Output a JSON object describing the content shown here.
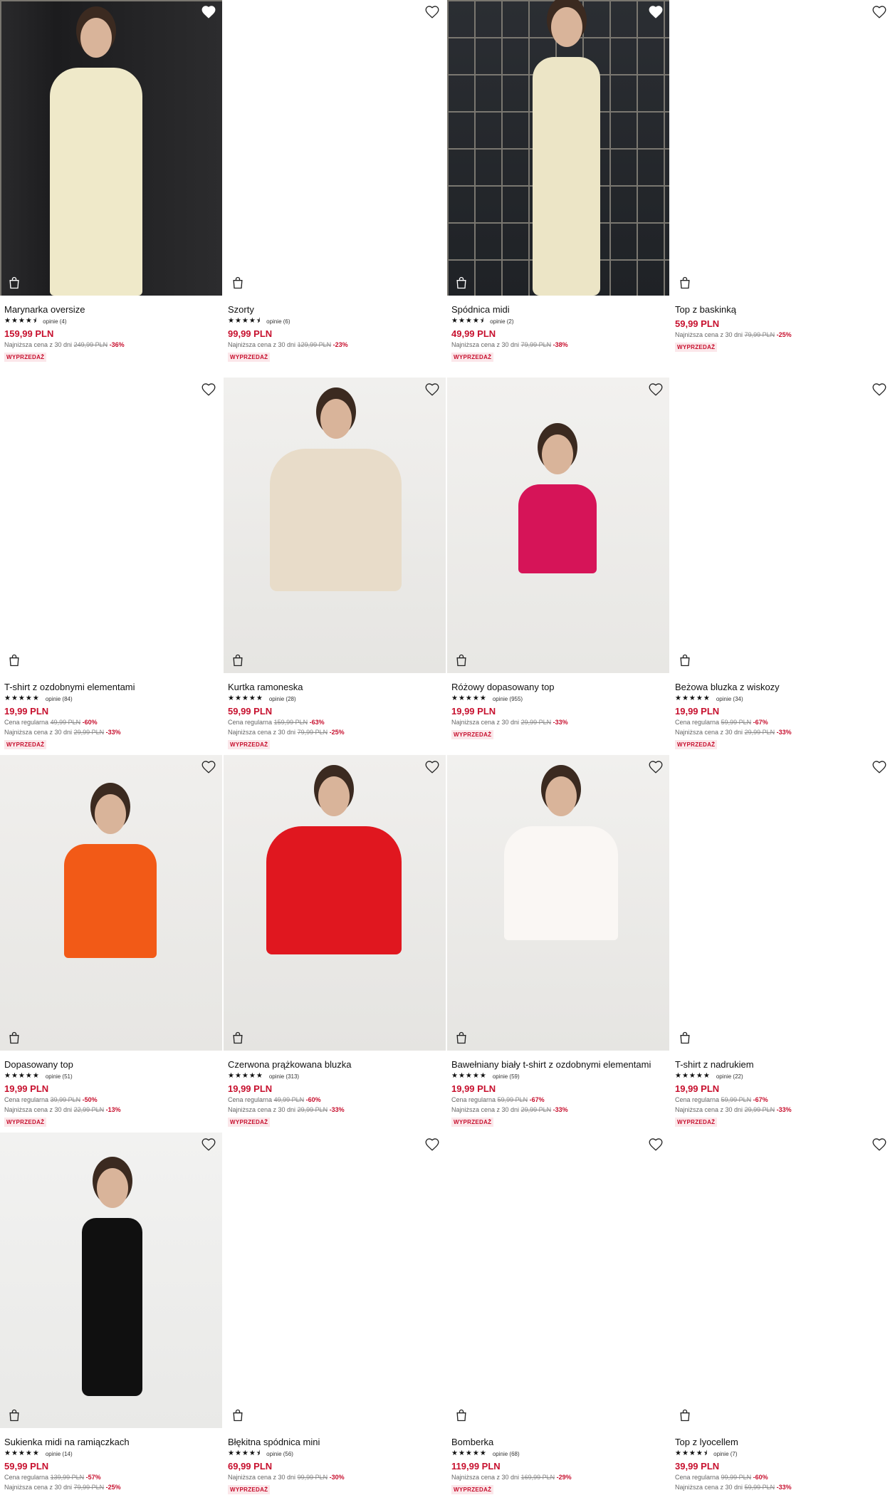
{
  "products": [
    {
      "name": "Marynarka oversize",
      "stars": "★★★★⯨",
      "reviews": "opinie (4)",
      "price": "159,99 PLN",
      "history": [
        {
          "label": "Najniższa cena z 30 dni",
          "old": "249,99 PLN",
          "disc": "-36%"
        }
      ],
      "badge": "WYPRZEDAŻ",
      "favorited": true,
      "image": "photo"
    },
    {
      "name": "Szorty",
      "stars": "★★★★⯨",
      "reviews": "opinie (6)",
      "price": "99,99 PLN",
      "history": [
        {
          "label": "Najniższa cena z 30 dni",
          "old": "129,99 PLN",
          "disc": "-23%"
        }
      ],
      "badge": "WYPRZEDAŻ",
      "favorited": false,
      "image": "blank"
    },
    {
      "name": "Spódnica midi",
      "stars": "★★★★⯨",
      "reviews": "opinie (2)",
      "price": "49,99 PLN",
      "history": [
        {
          "label": "Najniższa cena z 30 dni",
          "old": "79,99 PLN",
          "disc": "-38%"
        }
      ],
      "badge": "WYPRZEDAŻ",
      "favorited": true,
      "image": "photo"
    },
    {
      "name": "Top z baskinką",
      "stars": "",
      "reviews": "",
      "price": "59,99 PLN",
      "history": [
        {
          "label": "Najniższa cena z 30 dni",
          "old": "79,99 PLN",
          "disc": "-25%"
        }
      ],
      "badge": "WYPRZEDAŻ",
      "favorited": false,
      "image": "blank"
    },
    {
      "name": "T-shirt z ozdobnymi elementami",
      "stars": "★★★★★",
      "reviews": "opinie (84)",
      "price": "19,99 PLN",
      "history": [
        {
          "label": "Cena regularna",
          "old": "49,99 PLN",
          "disc": "-60%"
        },
        {
          "label": "Najniższa cena z 30 dni",
          "old": "29,99 PLN",
          "disc": "-33%"
        }
      ],
      "badge": "WYPRZEDAŻ",
      "favorited": false,
      "image": "blank"
    },
    {
      "name": "Kurtka ramoneska",
      "stars": "★★★★★",
      "reviews": "opinie (28)",
      "price": "59,99 PLN",
      "history": [
        {
          "label": "Cena regularna",
          "old": "159,99 PLN",
          "disc": "-63%"
        },
        {
          "label": "Najniższa cena z 30 dni",
          "old": "79,99 PLN",
          "disc": "-25%"
        }
      ],
      "badge": "WYPRZEDAŻ",
      "favorited": false,
      "image": "photo"
    },
    {
      "name": "Różowy dopasowany top",
      "stars": "★★★★★",
      "reviews": "opinie (955)",
      "price": "19,99 PLN",
      "history": [
        {
          "label": "Najniższa cena z 30 dni",
          "old": "29,99 PLN",
          "disc": "-33%"
        }
      ],
      "badge": "WYPRZEDAŻ",
      "favorited": false,
      "image": "photo"
    },
    {
      "name": "Beżowa bluzka z wiskozy",
      "stars": "★★★★★",
      "reviews": "opinie (34)",
      "price": "19,99 PLN",
      "history": [
        {
          "label": "Cena regularna",
          "old": "59,99 PLN",
          "disc": "-67%"
        },
        {
          "label": "Najniższa cena z 30 dni",
          "old": "29,99 PLN",
          "disc": "-33%"
        }
      ],
      "badge": "WYPRZEDAŻ",
      "favorited": false,
      "image": "blank"
    },
    {
      "name": "Dopasowany top",
      "stars": "★★★★★",
      "reviews": "opinie (51)",
      "price": "19,99 PLN",
      "history": [
        {
          "label": "Cena regularna",
          "old": "39,99 PLN",
          "disc": "-50%"
        },
        {
          "label": "Najniższa cena z 30 dni",
          "old": "22,99 PLN",
          "disc": "-13%"
        }
      ],
      "badge": "WYPRZEDAŻ",
      "favorited": false,
      "image": "photo"
    },
    {
      "name": "Czerwona prążkowana bluzka",
      "stars": "★★★★★",
      "reviews": "opinie (313)",
      "price": "19,99 PLN",
      "history": [
        {
          "label": "Cena regularna",
          "old": "49,99 PLN",
          "disc": "-60%"
        },
        {
          "label": "Najniższa cena z 30 dni",
          "old": "29,99 PLN",
          "disc": "-33%"
        }
      ],
      "badge": "WYPRZEDAŻ",
      "favorited": false,
      "image": "photo"
    },
    {
      "name": "Bawełniany biały t-shirt z ozdobnymi elementami",
      "stars": "★★★★★",
      "reviews": "opinie (59)",
      "price": "19,99 PLN",
      "history": [
        {
          "label": "Cena regularna",
          "old": "59,99 PLN",
          "disc": "-67%"
        },
        {
          "label": "Najniższa cena z 30 dni",
          "old": "29,99 PLN",
          "disc": "-33%"
        }
      ],
      "badge": "WYPRZEDAŻ",
      "favorited": false,
      "image": "photo"
    },
    {
      "name": "T-shirt z nadrukiem",
      "stars": "★★★★★",
      "reviews": "opinie (22)",
      "price": "19,99 PLN",
      "history": [
        {
          "label": "Cena regularna",
          "old": "59,99 PLN",
          "disc": "-67%"
        },
        {
          "label": "Najniższa cena z 30 dni",
          "old": "29,99 PLN",
          "disc": "-33%"
        }
      ],
      "badge": "WYPRZEDAŻ",
      "favorited": false,
      "image": "blank"
    },
    {
      "name": "Sukienka midi na ramiączkach",
      "stars": "★★★★★",
      "reviews": "opinie (14)",
      "price": "59,99 PLN",
      "history": [
        {
          "label": "Cena regularna",
          "old": "139,99 PLN",
          "disc": "-57%"
        },
        {
          "label": "Najniższa cena z 30 dni",
          "old": "79,99 PLN",
          "disc": "-25%"
        }
      ],
      "badge": "",
      "favorited": false,
      "image": "photo"
    },
    {
      "name": "Błękitna spódnica mini",
      "stars": "★★★★⯨",
      "reviews": "opinie (56)",
      "price": "69,99 PLN",
      "history": [
        {
          "label": "Najniższa cena z 30 dni",
          "old": "99,99 PLN",
          "disc": "-30%"
        }
      ],
      "badge": "WYPRZEDAŻ",
      "favorited": false,
      "image": "blank"
    },
    {
      "name": "Bomberka",
      "stars": "★★★★★",
      "reviews": "opinie (68)",
      "price": "119,99 PLN",
      "history": [
        {
          "label": "Najniższa cena z 30 dni",
          "old": "169,99 PLN",
          "disc": "-29%"
        }
      ],
      "badge": "WYPRZEDAŻ",
      "favorited": false,
      "image": "blank"
    },
    {
      "name": "Top z lyocellem",
      "stars": "★★★★⯨",
      "reviews": "opinie (7)",
      "price": "39,99 PLN",
      "history": [
        {
          "label": "Cena regularna",
          "old": "99,99 PLN",
          "disc": "-60%"
        },
        {
          "label": "Najniższa cena z 30 dni",
          "old": "59,99 PLN",
          "disc": "-33%"
        }
      ],
      "badge": "",
      "favorited": false,
      "image": "blank"
    }
  ],
  "icons": {
    "favorite": "heart-icon",
    "cart": "shopping-bag-icon"
  },
  "colors": {
    "price": "#c7102e",
    "badge_bg": "#fbe7ea"
  }
}
